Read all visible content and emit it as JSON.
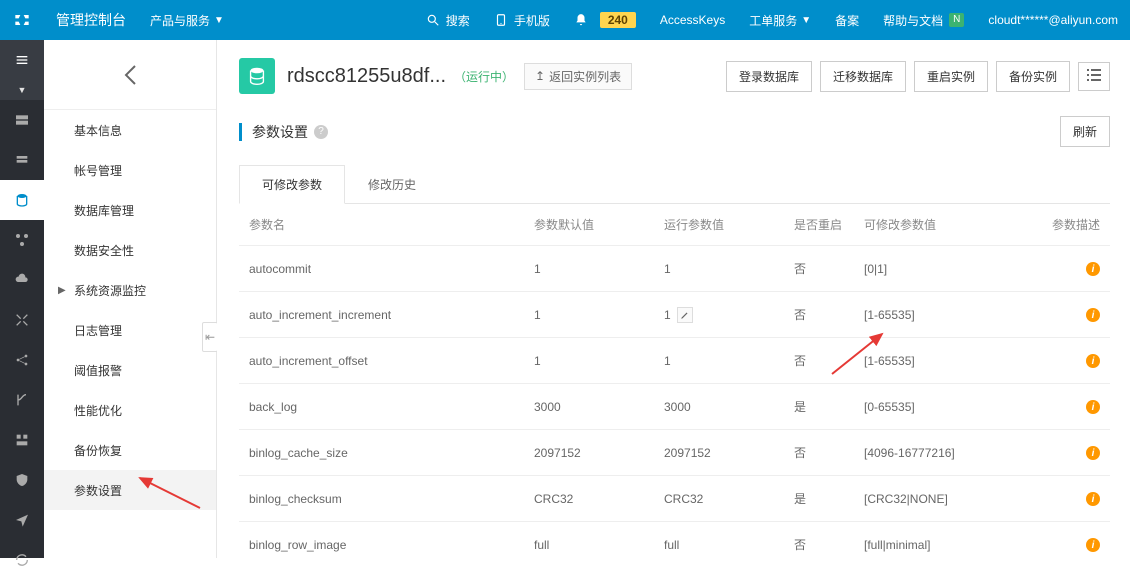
{
  "header": {
    "console": "管理控制台",
    "products": "产品与服务",
    "search": "搜索",
    "mobile": "手机版",
    "bell_count": "240",
    "accesskeys": "AccessKeys",
    "ticket": "工单服务",
    "beian": "备案",
    "help": "帮助与文档",
    "user": "cloudt******@aliyun.com"
  },
  "sidenav": {
    "items": [
      "基本信息",
      "帐号管理",
      "数据库管理",
      "数据安全性",
      "系统资源监控",
      "日志管理",
      "阈值报警",
      "性能优化",
      "备份恢复",
      "参数设置"
    ]
  },
  "page": {
    "title": "rdscc81255u8df...",
    "status": "（运行中）",
    "return": "返回实例列表",
    "buttons": {
      "login": "登录数据库",
      "migrate": "迁移数据库",
      "restart": "重启实例",
      "backup": "备份实例"
    },
    "refresh": "刷新"
  },
  "section": {
    "title": "参数设置"
  },
  "tabs": {
    "editable": "可修改参数",
    "history": "修改历史"
  },
  "table": {
    "headers": {
      "name": "参数名",
      "default": "参数默认值",
      "running": "运行参数值",
      "restart": "是否重启",
      "range": "可修改参数值",
      "desc": "参数描述"
    },
    "rows": [
      {
        "name": "autocommit",
        "default": "1",
        "running": "1",
        "restart": "否",
        "range": "[0|1]",
        "edit": false
      },
      {
        "name": "auto_increment_increment",
        "default": "1",
        "running": "1",
        "restart": "否",
        "range": "[1-65535]",
        "edit": true
      },
      {
        "name": "auto_increment_offset",
        "default": "1",
        "running": "1",
        "restart": "否",
        "range": "[1-65535]",
        "edit": false
      },
      {
        "name": "back_log",
        "default": "3000",
        "running": "3000",
        "restart": "是",
        "range": "[0-65535]",
        "edit": false
      },
      {
        "name": "binlog_cache_size",
        "default": "2097152",
        "running": "2097152",
        "restart": "否",
        "range": "[4096-16777216]",
        "edit": false
      },
      {
        "name": "binlog_checksum",
        "default": "CRC32",
        "running": "CRC32",
        "restart": "是",
        "range": "[CRC32|NONE]",
        "edit": false
      },
      {
        "name": "binlog_row_image",
        "default": "full",
        "running": "full",
        "restart": "否",
        "range": "[full|minimal]",
        "edit": false
      }
    ]
  }
}
